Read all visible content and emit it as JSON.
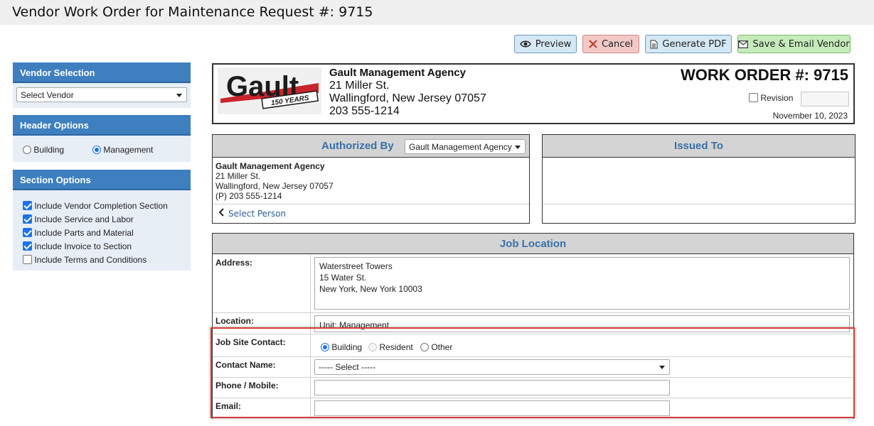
{
  "page": {
    "title": "Vendor Work Order for Maintenance Request #: 9715"
  },
  "toolbar": {
    "preview_label": "Preview",
    "cancel_label": "Cancel",
    "pdf_label": "Generate PDF",
    "save_label": "Save & Email Vendor"
  },
  "sidebar": {
    "vendor_selection": {
      "title": "Vendor Selection",
      "select_value": "Select Vendor"
    },
    "header_options": {
      "title": "Header Options",
      "building_label": "Building",
      "management_label": "Management",
      "selected": "Management"
    },
    "section_options": {
      "title": "Section Options",
      "items": [
        {
          "label": "Include Vendor Completion Section",
          "checked": true
        },
        {
          "label": "Include Service and Labor",
          "checked": true
        },
        {
          "label": "Include Parts and Material",
          "checked": true
        },
        {
          "label": "Include Invoice to Section",
          "checked": true
        },
        {
          "label": "Include Terms and Conditions",
          "checked": false
        }
      ]
    }
  },
  "header": {
    "logo_text": "Gault",
    "logo_banner": "150 YEARS",
    "agency_name": "Gault Management Agency",
    "address1": "21 Miller St.",
    "address2": "Wallingford, New Jersey 07057",
    "phone": "203 555-1214",
    "work_order_title": "WORK ORDER #: 9715",
    "revision_label": "Revision",
    "date": "November 10, 2023"
  },
  "authorized": {
    "title": "Authorized By",
    "select_value": "Gault Management Agency",
    "name": "Gault Management Agency",
    "address1": "21 Miller St.",
    "address2": "Wallingford, New Jersey 07057",
    "phone": "(P) 203 555-1214",
    "select_person_label": "Select Person"
  },
  "issued": {
    "title": "Issued To"
  },
  "job_location": {
    "title": "Job Location",
    "address_label": "Address:",
    "address_lines": [
      "Waterstreet Towers",
      "15 Water St.",
      "New York, New York 10003"
    ],
    "location_label": "Location:",
    "location_value": "Unit: Management",
    "contact_label": "Job Site Contact:",
    "contact_options": [
      "Building",
      "Resident",
      "Other"
    ],
    "contact_selected": "Building",
    "contact_name_label": "Contact Name:",
    "contact_name_value": "----- Select -----",
    "phone_label": "Phone / Mobile:",
    "email_label": "Email:"
  },
  "colors": {
    "accent": "#3d7fbf",
    "highlight": "#d83a3a",
    "section_title": "#3a70a8"
  }
}
